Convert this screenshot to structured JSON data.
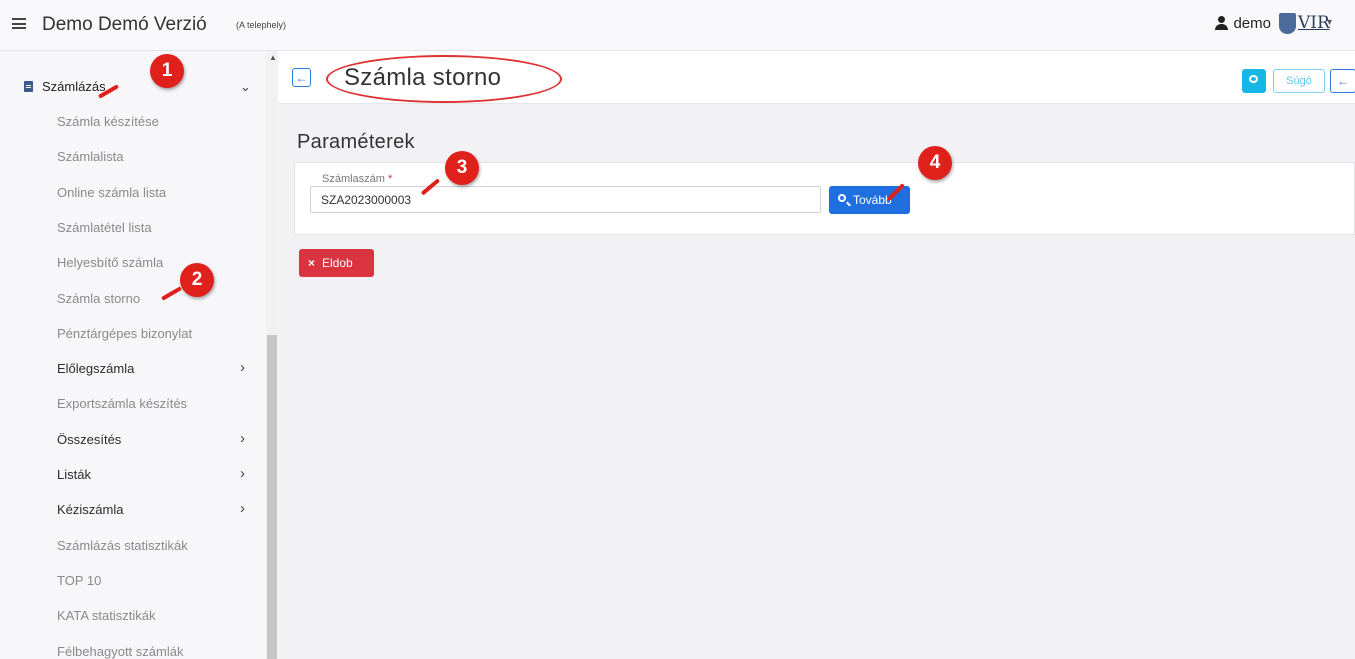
{
  "header": {
    "app_title": "Demo Demó Verzió",
    "app_subtitle": "(A telephely)",
    "user_name": "demo",
    "logo_text": "VIR"
  },
  "sidebar": {
    "top_item": "Számlázás",
    "items": [
      {
        "label": "Számla készítése",
        "type": "sub"
      },
      {
        "label": "Számlalista",
        "type": "sub"
      },
      {
        "label": "Online számla lista",
        "type": "sub"
      },
      {
        "label": "Számlatétel lista",
        "type": "sub"
      },
      {
        "label": "Helyesbítő számla",
        "type": "sub"
      },
      {
        "label": "Számla storno",
        "type": "sub"
      },
      {
        "label": "Pénztárgépes bizonylat",
        "type": "sub"
      },
      {
        "label": "Előlegszámla",
        "type": "parent"
      },
      {
        "label": "Exportszámla készítés",
        "type": "sub"
      },
      {
        "label": "Összesítés",
        "type": "parent"
      },
      {
        "label": "Listák",
        "type": "parent"
      },
      {
        "label": "Kéziszámla",
        "type": "parent"
      },
      {
        "label": "Számlázás statisztikák",
        "type": "sub"
      },
      {
        "label": "TOP 10",
        "type": "sub"
      },
      {
        "label": "KATA statisztikák",
        "type": "sub"
      },
      {
        "label": "Félbehagyott számlák",
        "type": "sub"
      }
    ]
  },
  "page": {
    "title": "Számla storno",
    "help_label": "Súgó",
    "section_title": "Paraméterek",
    "field_label": "Számlaszám",
    "field_required_mark": "*",
    "field_value": "SZA2023000003",
    "next_button": "Tovább",
    "discard_button": "Eldob"
  },
  "markers": [
    "1",
    "2",
    "3",
    "4"
  ],
  "colors": {
    "primary": "#1f6fe0",
    "danger": "#d9343f",
    "info": "#17b7e5",
    "marker": "#e0201b"
  }
}
